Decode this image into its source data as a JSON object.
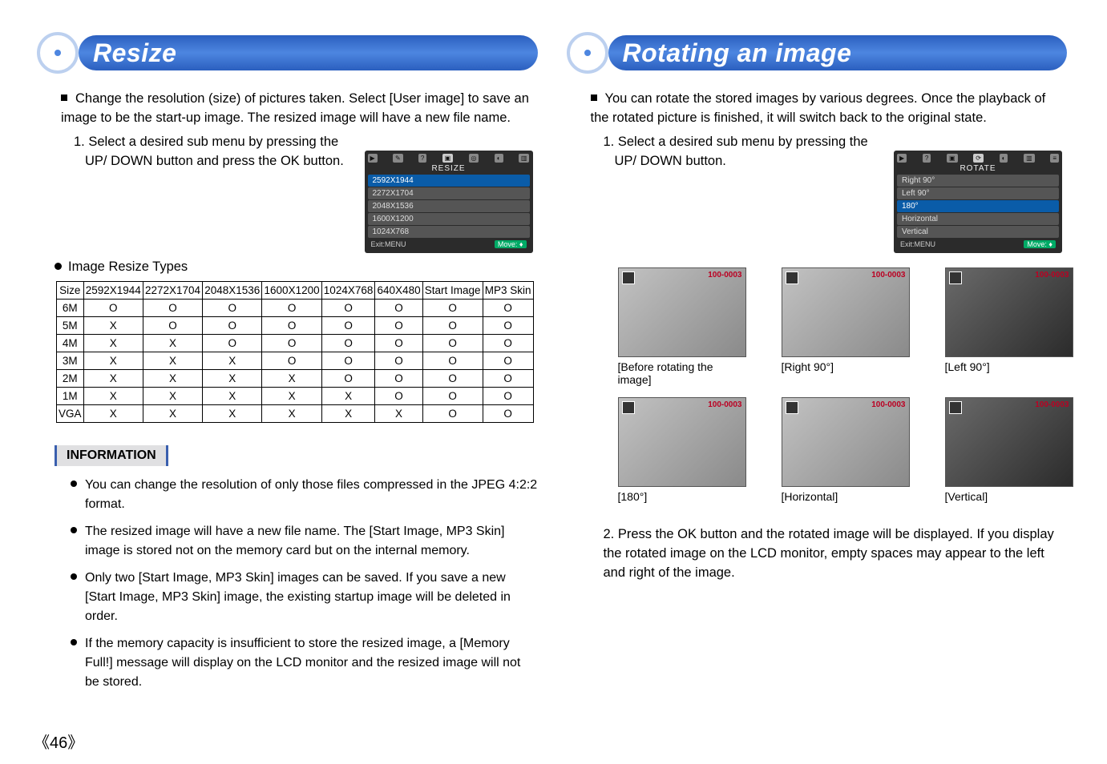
{
  "left": {
    "title": "Resize",
    "intro": "Change the resolution (size) of pictures taken. Select [User image] to save an image to be the start-up image. The resized image will have a new file name.",
    "step1a": "1. Select a desired sub menu by pressing the",
    "step1b": "UP/ DOWN button and press the OK button.",
    "menu": {
      "title": "RESIZE",
      "items": [
        "2592X1944",
        "2272X1704",
        "2048X1536",
        "1600X1200",
        "1024X768"
      ],
      "exit": "Exit:MENU",
      "move": "Move:"
    },
    "types_label": "Image Resize Types",
    "table": {
      "headers": [
        "Size",
        "2592X1944",
        "2272X1704",
        "2048X1536",
        "1600X1200",
        "1024X768",
        "640X480",
        "Start Image",
        "MP3 Skin"
      ],
      "rows": [
        [
          "6M",
          "O",
          "O",
          "O",
          "O",
          "O",
          "O",
          "O",
          "O"
        ],
        [
          "5M",
          "X",
          "O",
          "O",
          "O",
          "O",
          "O",
          "O",
          "O"
        ],
        [
          "4M",
          "X",
          "X",
          "O",
          "O",
          "O",
          "O",
          "O",
          "O"
        ],
        [
          "3M",
          "X",
          "X",
          "X",
          "O",
          "O",
          "O",
          "O",
          "O"
        ],
        [
          "2M",
          "X",
          "X",
          "X",
          "X",
          "O",
          "O",
          "O",
          "O"
        ],
        [
          "1M",
          "X",
          "X",
          "X",
          "X",
          "X",
          "O",
          "O",
          "O"
        ],
        [
          "VGA",
          "X",
          "X",
          "X",
          "X",
          "X",
          "X",
          "O",
          "O"
        ]
      ]
    },
    "info_title": "INFORMATION",
    "info_items": [
      "You can change the resolution of only those files compressed in the JPEG 4:2:2 format.",
      "The resized image will have a new file name. The [Start Image, MP3 Skin] image is stored not on the memory card but on the internal memory.",
      "Only two [Start Image, MP3 Skin] images can be saved. If you save a new [Start Image, MP3 Skin] image, the existing startup image will be deleted in order.",
      "If the memory capacity is insufficient to store the resized image, a [Memory Full!] message will display on the LCD monitor and the resized image will not be stored."
    ]
  },
  "right": {
    "title": "Rotating an image",
    "intro": "You can rotate the stored images by various degrees. Once the playback of the rotated picture is finished, it will switch back to the original state.",
    "step1a": "1. Select a desired sub menu by pressing the",
    "step1b": "UP/ DOWN button.",
    "menu": {
      "title": "ROTATE",
      "items": [
        "Right 90°",
        "Left 90°",
        "180°",
        "Horizontal",
        "Vertical"
      ],
      "exit": "Exit:MENU",
      "move": "Move:"
    },
    "thumbs": {
      "id_tag": "100-0003",
      "caps": [
        "[Before rotating the image]",
        "[Right 90°]",
        "[Left 90°]",
        "[180°]",
        "[Horizontal]",
        "[Vertical]"
      ]
    },
    "step2": "2. Press the OK button and the rotated image will be displayed. If you display the rotated image on the LCD monitor, empty spaces may appear to the left and right of the image."
  },
  "page_number": "46"
}
